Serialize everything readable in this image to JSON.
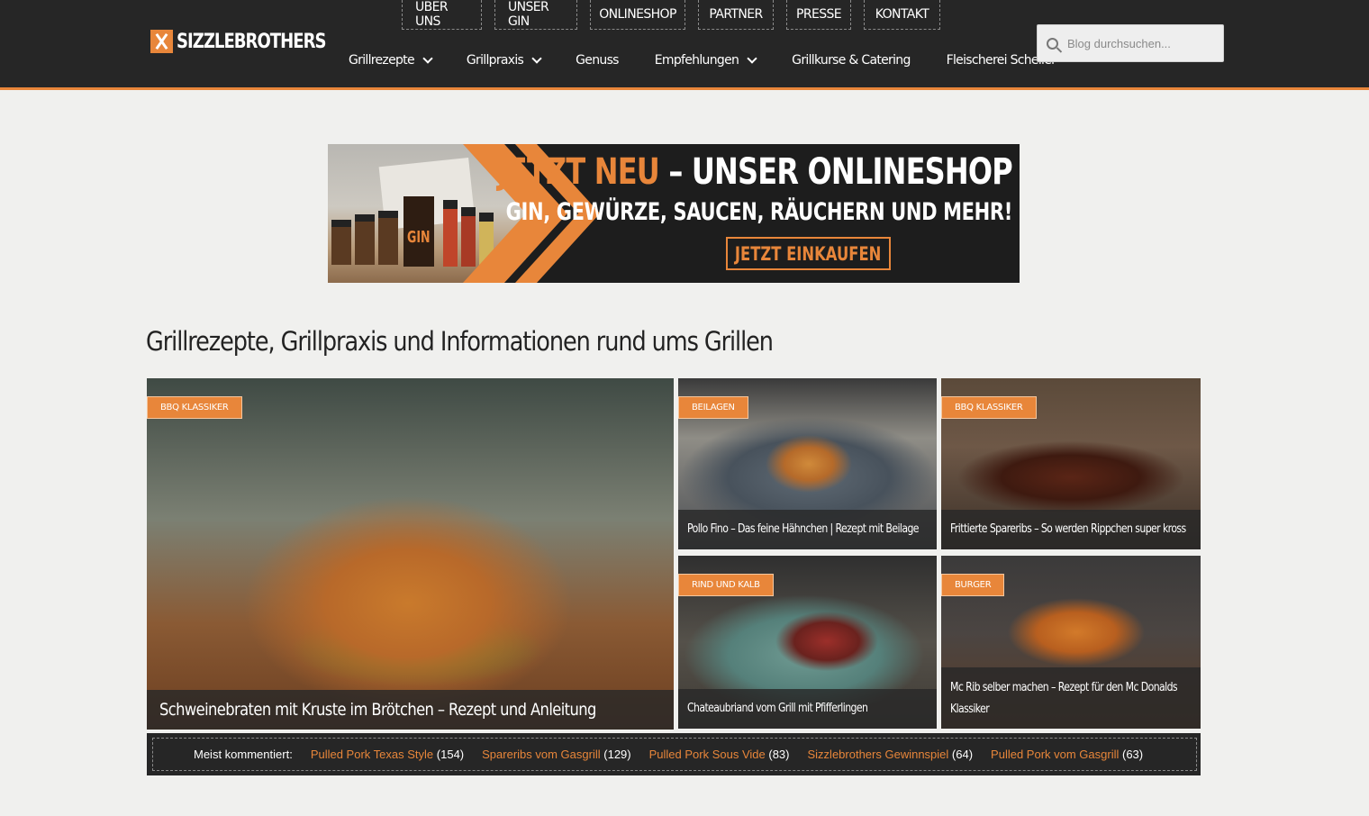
{
  "header": {
    "logo_text": "SIZZLEBROTHERS",
    "top_nav": [
      "ÜBER UNS",
      "UNSER GIN",
      "ONLINESHOP",
      "PARTNER",
      "PRESSE",
      "KONTAKT"
    ],
    "main_nav": [
      {
        "label": "Grillrezepte",
        "dropdown": true
      },
      {
        "label": "Grillpraxis",
        "dropdown": true
      },
      {
        "label": "Genuss",
        "dropdown": false
      },
      {
        "label": "Empfehlungen",
        "dropdown": true
      },
      {
        "label": "Grillkurse & Catering",
        "dropdown": false
      },
      {
        "label": "Fleischerei Scheller",
        "dropdown": false
      }
    ],
    "search_placeholder": "Blog durchsuchen..."
  },
  "banner": {
    "line1_accent": "JETZT NEU",
    "line1_rest": " – UNSER ONLINESHOP",
    "line2": "GIN, GEWÜRZE, SAUCEN, RÄUCHERN UND MEHR!",
    "cta": "JETZT EINKAUFEN",
    "gin_label": "GIN"
  },
  "headline": "Grillrezepte, Grillpraxis und Informationen rund ums Grillen",
  "posts": [
    {
      "badge": "BBQ KLASSIKER",
      "title": "Schweinebraten mit Kruste im Brötchen – Rezept und Anleitung"
    },
    {
      "badge": "BEILAGEN",
      "title": "Pollo Fino – Das feine Hähnchen | Rezept mit Beilage"
    },
    {
      "badge": "BBQ KLASSIKER",
      "title": "Frittierte Spareribs – So werden Rippchen super kross"
    },
    {
      "badge": "RIND UND KALB",
      "title": "Chateaubriand vom Grill mit Pfifferlingen"
    },
    {
      "badge": "BURGER",
      "title": "Mc Rib selber machen – Rezept für den Mc Donalds Klassiker"
    }
  ],
  "most_commented": {
    "label": "Meist kommentiert:",
    "items": [
      {
        "title": "Pulled Pork Texas Style",
        "count": "(154)"
      },
      {
        "title": "Spareribs vom Gasgrill",
        "count": "(129)"
      },
      {
        "title": "Pulled Pork Sous Vide",
        "count": "(83)"
      },
      {
        "title": "Sizzlebrothers Gewinnspiel",
        "count": "(64)"
      },
      {
        "title": "Pulled Pork vom Gasgrill",
        "count": "(63)"
      }
    ]
  },
  "colors": {
    "accent": "#e8863a",
    "header_bg": "#262626",
    "page_bg": "#f0f0ee"
  }
}
